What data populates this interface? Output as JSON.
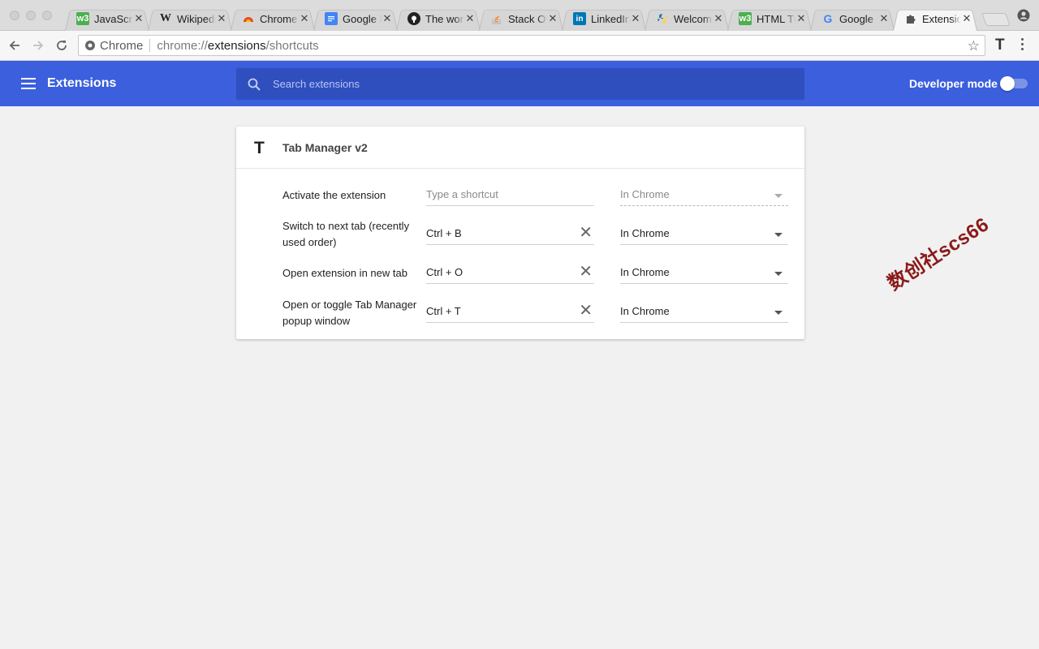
{
  "tabs": [
    {
      "title": "JavaScript",
      "favicon": "w3-icon",
      "fav_color": "#4caf50",
      "active": false
    },
    {
      "title": "Wikipedia",
      "favicon": "wikipedia-icon",
      "fav_color": "#222222",
      "active": false
    },
    {
      "title": "Chrome",
      "favicon": "chrome-icon",
      "fav_color": "#e34c26",
      "active": false
    },
    {
      "title": "Google Docs",
      "favicon": "google-docs-icon",
      "fav_color": "#4285f4",
      "active": false
    },
    {
      "title": "The world",
      "favicon": "github-icon",
      "fav_color": "#222222",
      "active": false
    },
    {
      "title": "Stack Overflow",
      "favicon": "stackoverflow-icon",
      "fav_color": "#f48024",
      "active": false
    },
    {
      "title": "LinkedIn",
      "favicon": "linkedin-icon",
      "fav_color": "#0077b5",
      "active": false
    },
    {
      "title": "Welcome",
      "favicon": "python-icon",
      "fav_color": "#3776ab",
      "active": false
    },
    {
      "title": "HTML Tutorial",
      "favicon": "w3-icon",
      "fav_color": "#4caf50",
      "active": false
    },
    {
      "title": "Google",
      "favicon": "google-icon",
      "fav_color": "#4285f4",
      "active": false
    },
    {
      "title": "Extensions",
      "favicon": "puzzle-icon",
      "fav_color": "#555555",
      "active": true
    }
  ],
  "omnibox": {
    "chip": "Chrome",
    "url_prefix": "chrome://",
    "url_host": "extensions",
    "url_path": "/shortcuts"
  },
  "toolbar": {
    "extension_letter": "T"
  },
  "header": {
    "title": "Extensions",
    "search_placeholder": "Search extensions",
    "developer_mode_label": "Developer mode",
    "developer_mode_on": false
  },
  "extension": {
    "icon_letter": "T",
    "name": "Tab Manager v2",
    "commands": [
      {
        "label": "Activate the extension",
        "shortcut": "Type a shortcut",
        "empty": true,
        "scope": "In Chrome",
        "scope_disabled": true
      },
      {
        "label": "Switch to next tab (recently used order)",
        "shortcut": "Ctrl + B",
        "empty": false,
        "scope": "In Chrome",
        "scope_disabled": false
      },
      {
        "label": "Open extension in new tab",
        "shortcut": "Ctrl + O",
        "empty": false,
        "scope": "In Chrome",
        "scope_disabled": false
      },
      {
        "label": "Open or toggle Tab Manager popup window",
        "shortcut": "Ctrl + T",
        "empty": false,
        "scope": "In Chrome",
        "scope_disabled": false
      }
    ]
  },
  "watermark": "数创社scs66",
  "colors": {
    "header_bg": "#3b5fdd",
    "search_bg": "#2f4fbf",
    "page_bg": "#f1f1f1"
  }
}
